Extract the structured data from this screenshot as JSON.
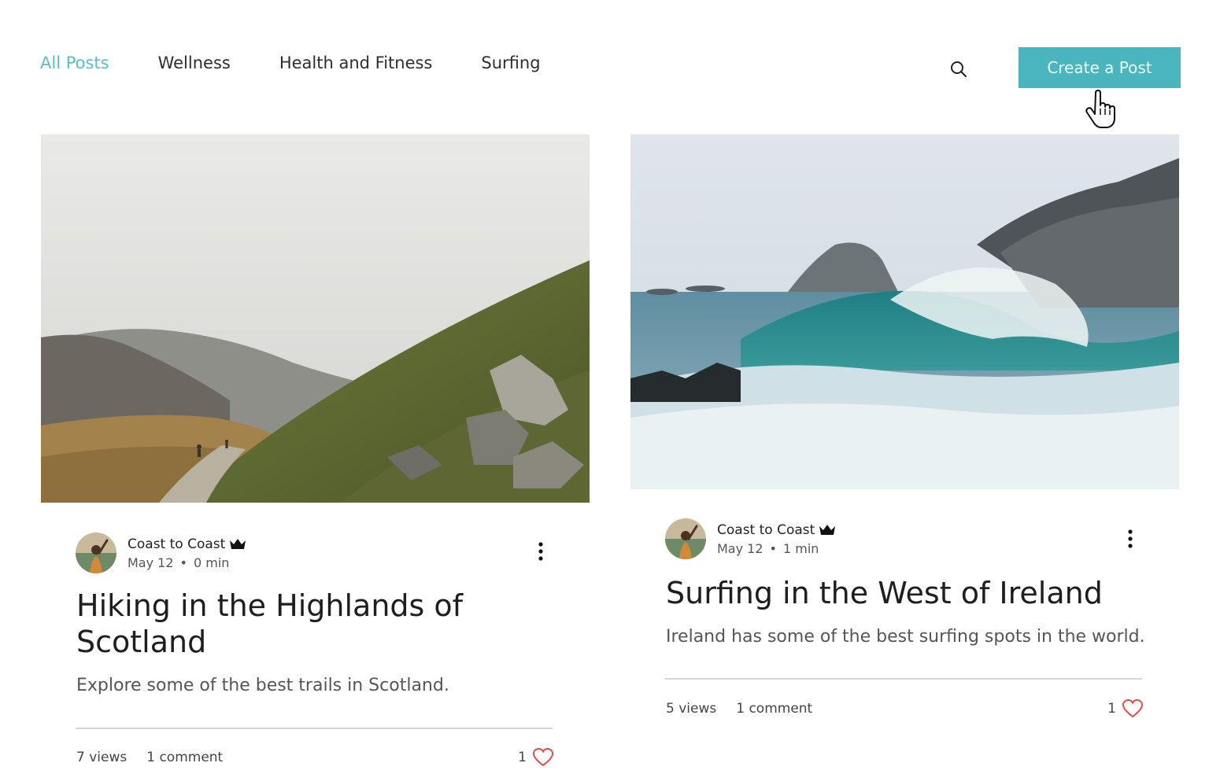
{
  "nav": {
    "items": [
      {
        "label": "All Posts",
        "active": true
      },
      {
        "label": "Wellness",
        "active": false
      },
      {
        "label": "Health and Fitness",
        "active": false
      },
      {
        "label": "Surfing",
        "active": false
      }
    ]
  },
  "header": {
    "search_icon": "search-icon",
    "create_button_label": "Create a Post"
  },
  "colors": {
    "accent": "#4ab5bd",
    "active_nav": "#57bfc7",
    "heart": "#e44a4a"
  },
  "posts": [
    {
      "author": "Coast to Coast",
      "date": "May 12",
      "read_time": "0 min",
      "title": "Hiking in the Highlands of Scotland",
      "excerpt": "Explore some of the best trails in Scotland.",
      "views": "7 views",
      "comments": "1 comment",
      "likes": "1"
    },
    {
      "author": "Coast to Coast",
      "date": "May 12",
      "read_time": "1 min",
      "title": "Surfing in the West of Ireland",
      "excerpt": "Ireland has some of the best surfing spots in the world.",
      "views": "5 views",
      "comments": "1 comment",
      "likes": "1"
    }
  ]
}
